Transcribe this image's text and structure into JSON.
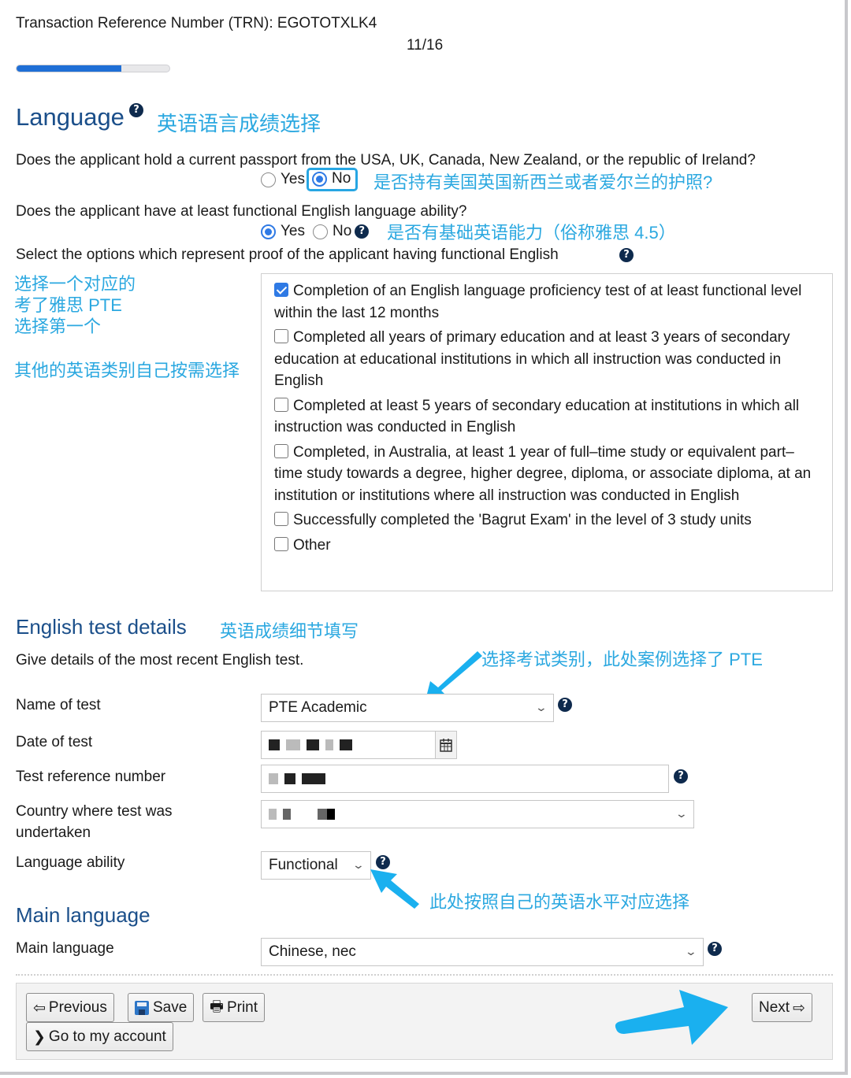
{
  "header": {
    "trn_label": "Transaction Reference Number (TRN): EGOTOTXLK4",
    "step": "11/16",
    "progress_fraction": 0.6875
  },
  "language_section": {
    "title": "Language",
    "annotation": "英语语言成绩选择",
    "q1": {
      "text": "Does the applicant hold a current passport from the USA, UK, Canada, New Zealand, or the republic of Ireland?",
      "options": [
        "Yes",
        "No"
      ],
      "selected": "No",
      "annotation": "是否持有美国英国新西兰或者爱尔兰的护照?"
    },
    "q2": {
      "text": "Does the applicant have at least functional English language ability?",
      "options": [
        "Yes",
        "No"
      ],
      "selected": "Yes",
      "annotation": "是否有基础英语能力（俗称雅思 4.5）"
    },
    "q3_text": "Select the options which represent proof of the applicant having functional English",
    "side_annotation_lines": [
      "选择一个对应的",
      "考了雅思 PTE",
      "选择第一个"
    ],
    "side_annotation_2": "其他的英语类别自己按需选择",
    "proof_options": [
      {
        "label": "Completion of an English language proficiency test of at least functional level within the last 12 months",
        "checked": true
      },
      {
        "label": "Completed all years of primary education and at least 3 years of secondary education at educational institutions in which all instruction was conducted in English",
        "checked": false
      },
      {
        "label": "Completed at least 5 years of secondary education at institutions in which all instruction was conducted in English",
        "checked": false
      },
      {
        "label": "Completed, in Australia, at least 1 year of full–time study or equivalent part–time study towards a degree, higher degree, diploma, or associate diploma, at an institution or institutions where all instruction was conducted in English",
        "checked": false
      },
      {
        "label": "Successfully completed the 'Bagrut Exam' in the level of 3 study units",
        "checked": false
      },
      {
        "label": "Other",
        "checked": false
      }
    ]
  },
  "test_details": {
    "title": "English test details",
    "annotation": "英语成绩细节填写",
    "intro": "Give details of the most recent English test.",
    "arrow_annotation": "选择考试类别，此处案例选择了 PTE",
    "name_of_test": {
      "label": "Name of test",
      "value": "PTE Academic"
    },
    "date_of_test": {
      "label": "Date of test",
      "value": "[redacted]"
    },
    "reference_number": {
      "label": "Test reference number",
      "value": "[redacted]"
    },
    "country": {
      "label": "Country where test was undertaken",
      "value": "[redacted]"
    },
    "language_ability": {
      "label": "Language ability",
      "value": "Functional"
    },
    "ability_annotation": "此处按照自己的英语水平对应选择"
  },
  "main_language": {
    "title": "Main language",
    "label": "Main language",
    "value": "Chinese, nec"
  },
  "buttons": {
    "previous": "Previous",
    "save": "Save",
    "print": "Print",
    "account": "Go to my account",
    "next": "Next"
  },
  "colors": {
    "heading": "#1b4f8a",
    "annotation": "#2ba8e0",
    "progress": "#1f6fd6",
    "radio_selected": "#2f7ae5"
  }
}
